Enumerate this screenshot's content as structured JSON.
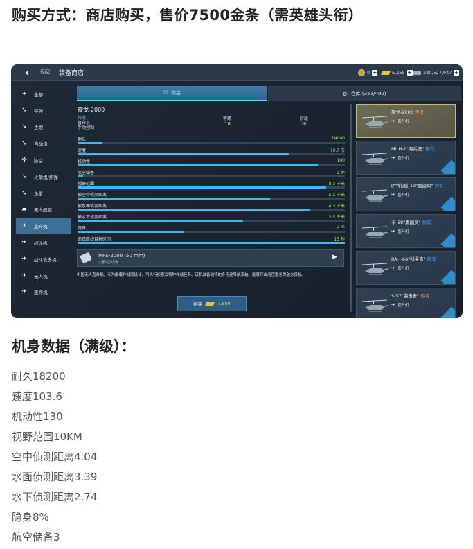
{
  "headline": "购买方式：商店购买，售价7500金条（需英雄头衔）",
  "game": {
    "topbar": {
      "back_label": "返回",
      "title": "装备商店",
      "currency": [
        {
          "icon": "medal-coin-icon",
          "value": "0"
        },
        {
          "icon": "gold-bar-icon",
          "value": "5,255"
        },
        {
          "icon": "cash-icon",
          "value": "380,527,947"
        }
      ]
    },
    "sidebar": [
      {
        "label": "全部",
        "icon": "all-icon",
        "active": false
      },
      {
        "label": "导弹",
        "icon": "missile-icon",
        "active": false
      },
      {
        "label": "主炮",
        "icon": "main-gun-icon",
        "active": false
      },
      {
        "label": "自动炮",
        "icon": "autocannon-icon",
        "active": false
      },
      {
        "label": "防空",
        "icon": "air-defense-icon",
        "active": false
      },
      {
        "label": "火箭炮/炸弹",
        "icon": "rocket-icon",
        "active": false
      },
      {
        "label": "鱼雷",
        "icon": "torpedo-icon",
        "active": false
      },
      {
        "label": "无人舰艇",
        "icon": "drone-boat-icon",
        "active": false
      },
      {
        "label": "直升机",
        "icon": "helicopter-icon",
        "active": true
      },
      {
        "label": "战斗机",
        "icon": "fighter-icon",
        "active": false
      },
      {
        "label": "战斗攻击机",
        "icon": "attack-jet-icon",
        "active": false
      },
      {
        "label": "无人机",
        "icon": "uav-icon",
        "active": false
      },
      {
        "label": "轰炸机",
        "icon": "bomber-icon",
        "active": false
      }
    ],
    "tabs": {
      "store": "商店",
      "storage": "仓库 (355/400)"
    },
    "item": {
      "name": "旋戈-2000",
      "rarity": "传说",
      "type": "直升机",
      "control": "手动控制",
      "level_label": "等级",
      "level": "18",
      "tier_label": "阶级",
      "tier": "III",
      "stats": [
        {
          "name": "耐久",
          "value": "14000",
          "fill": 0.09
        },
        {
          "name": "速度",
          "value": "79.7 节",
          "fill": 0.79
        },
        {
          "name": "机动性",
          "value": "100",
          "fill": 0.9
        },
        {
          "name": "航空储备",
          "value": "2 件",
          "fill": 0.02
        },
        {
          "name": "视野范围",
          "value": "8.3 千米",
          "fill": 0.93
        },
        {
          "name": "被空中侦测距离",
          "value": "5.2 千米",
          "fill": 0.72
        },
        {
          "name": "被水面侦测距离",
          "value": "4.3 千米",
          "fill": 0.87
        },
        {
          "name": "被水下侦测距离",
          "value": "3.5 千米",
          "fill": 0.62
        },
        {
          "name": "隐身",
          "value": "2 %",
          "fill": 0.4
        },
        {
          "name": "追踪航线目标时间",
          "value": "15 秒",
          "fill": 1.0
        }
      ],
      "weapon": {
        "name": "MPS-2000 (50 mm)",
        "type": "火箭炮/炸弹"
      },
      "description": "中国无人直升机，专为舰载作战而设计，可执行侦察及特种作战任务。该机装备独特的多用途导航系统，能够打击海空潜各类敌方目标。",
      "buy_label": "购买",
      "price": "7,500"
    },
    "cards": [
      {
        "name": "旋戈-2000",
        "rarity": "传说",
        "rarity_color": "orange",
        "type": "直升机",
        "selected": true
      },
      {
        "name": "MUH-1\"海兵鹰\"",
        "rarity": "稀有",
        "rarity_color": "blue",
        "type": "直升机",
        "selected": false
      },
      {
        "name": "[中航]直-19\"黑旋风\"",
        "rarity": "稀有",
        "rarity_color": "blue",
        "type": "直升机",
        "selected": false
      },
      {
        "name": "卡-58\"黑幽灵\"",
        "rarity": "稀有",
        "rarity_color": "blue",
        "type": "直升机",
        "selected": false
      },
      {
        "name": "RAH-66\"科曼奇\"",
        "rarity": "稀有",
        "rarity_color": "blue",
        "type": "直升机",
        "selected": false
      },
      {
        "name": "S-97\"袭击者\"",
        "rarity": "传说",
        "rarity_color": "orange",
        "type": "直升机",
        "selected": false
      }
    ]
  },
  "section_title": "机身数据（满级）：",
  "specs": [
    "耐久18200",
    "速度103.6",
    "机动性130",
    "视野范围10KM",
    "空中侦测距离4.04",
    "水面侦测距离3.39",
    "水下侦测距离2.74",
    "隐身8%",
    "航空储备3"
  ]
}
